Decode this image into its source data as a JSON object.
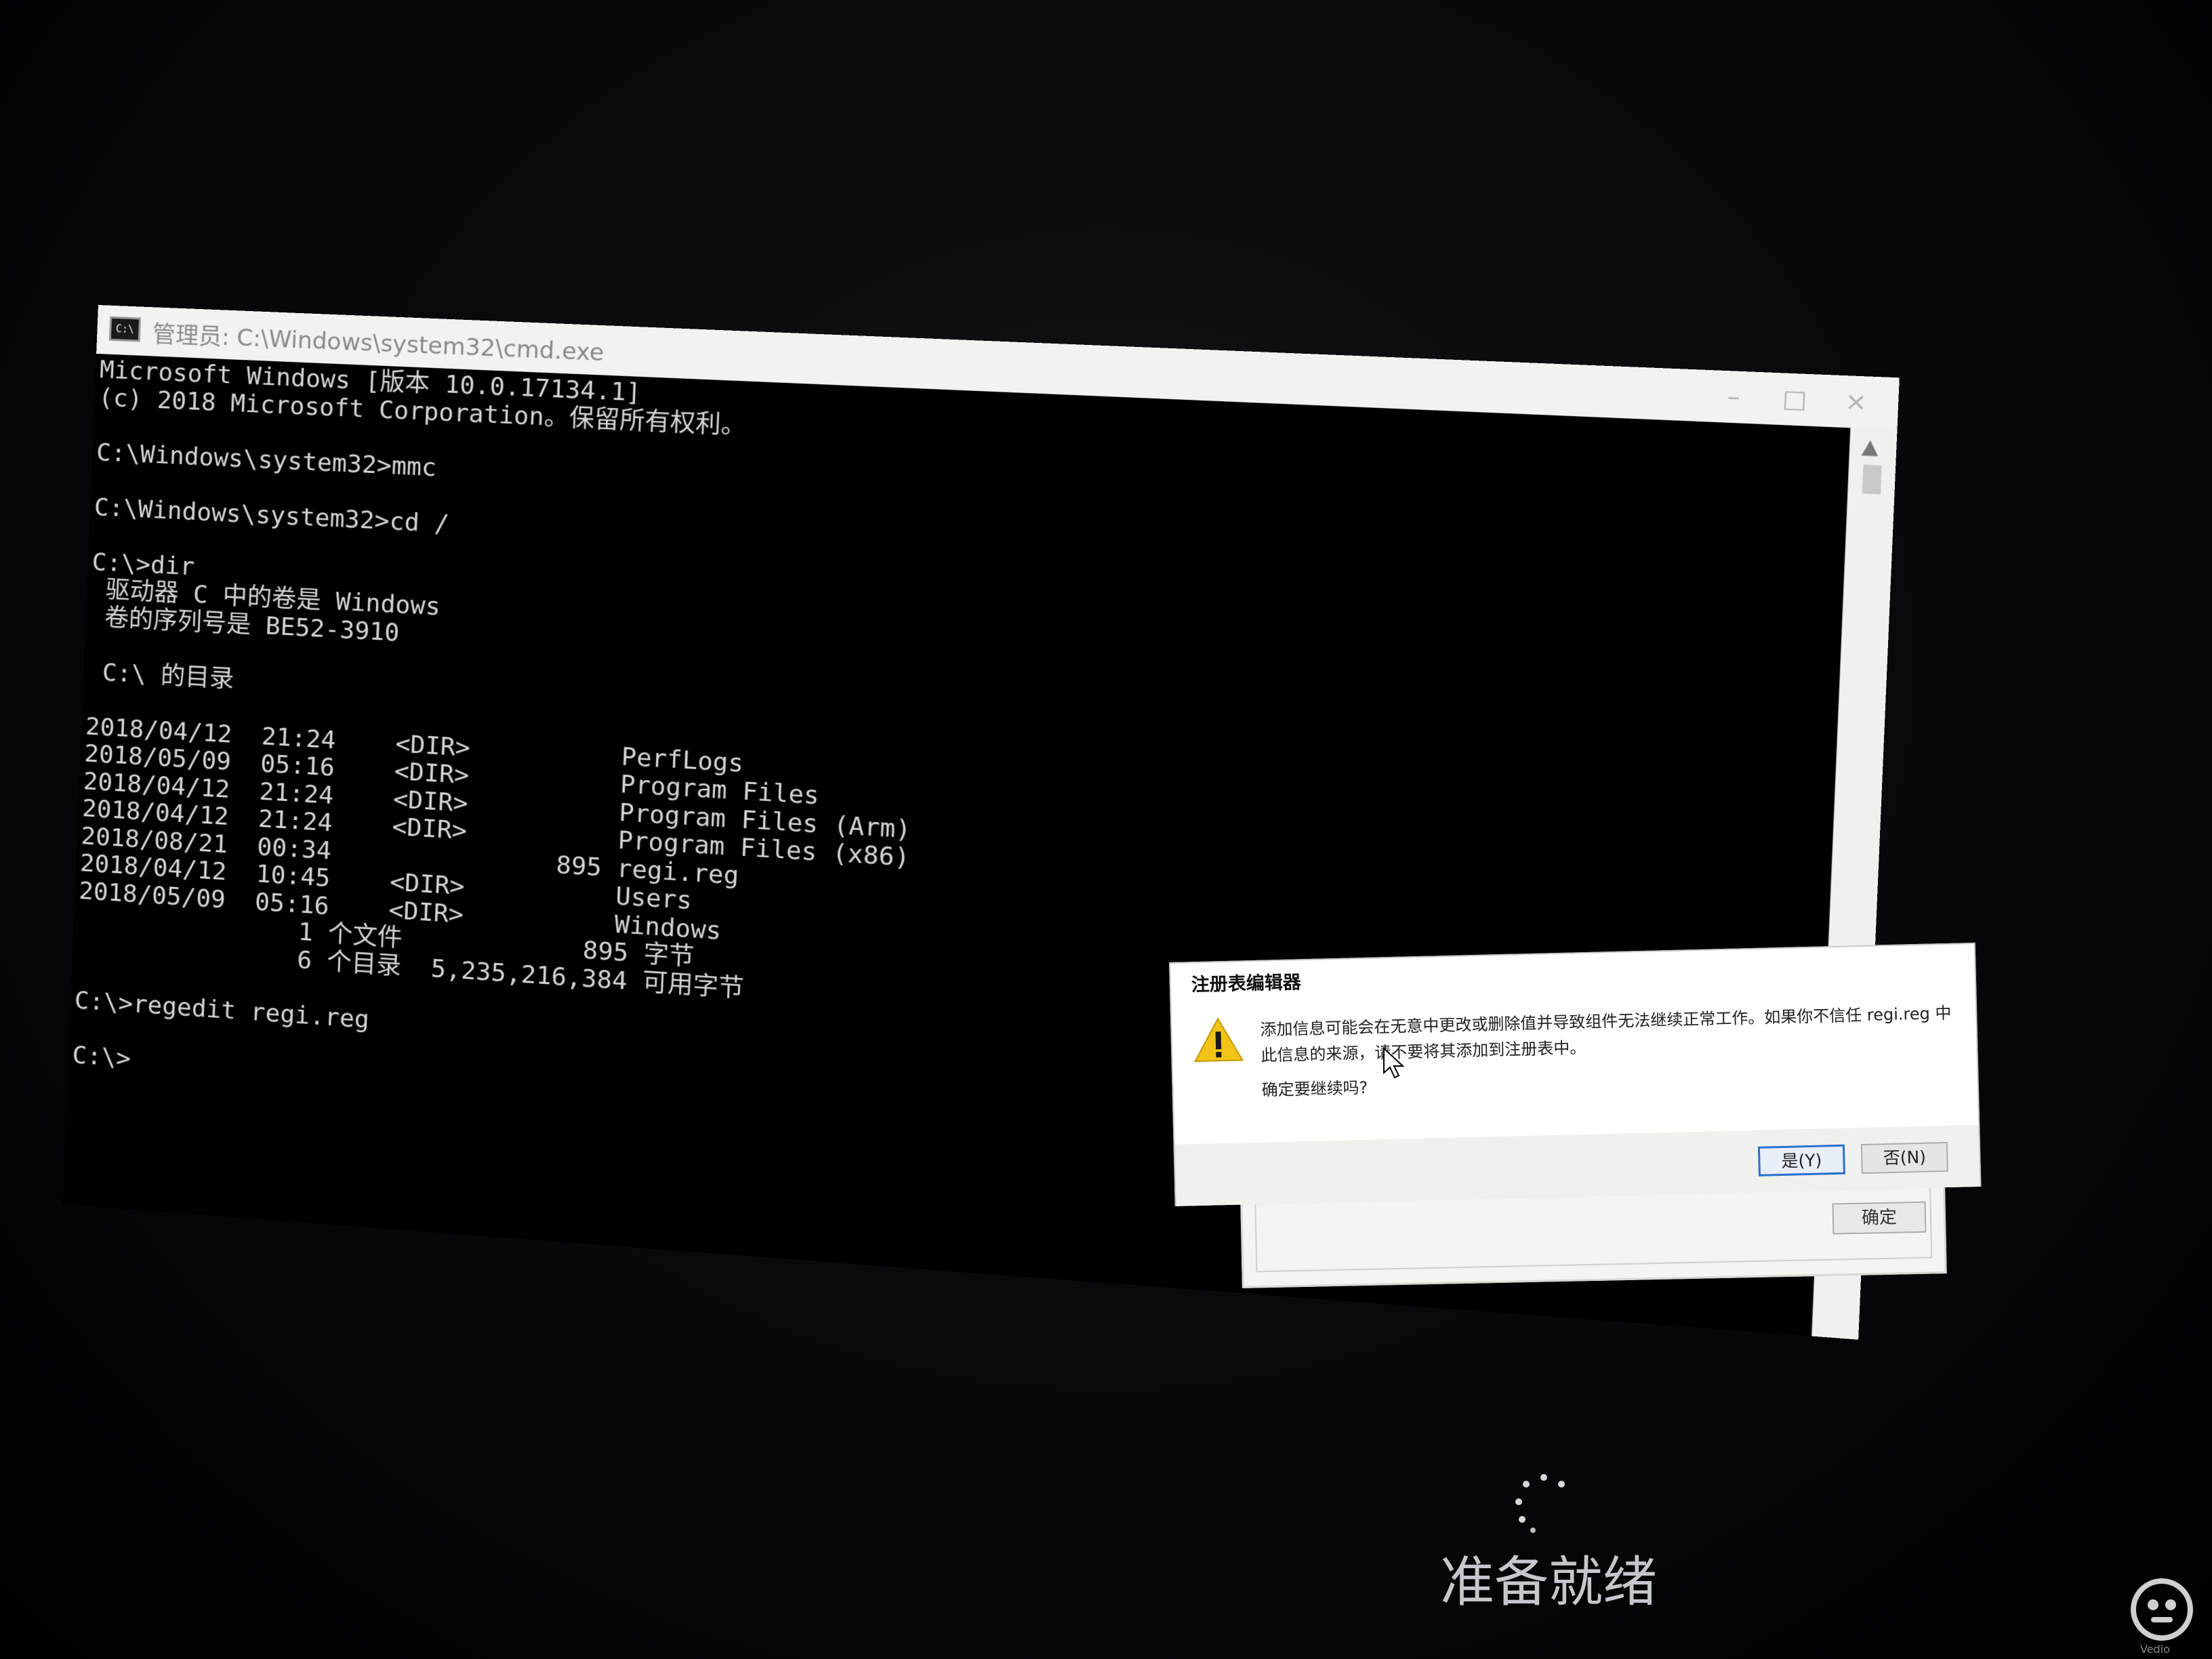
{
  "cmd": {
    "title": "管理员: C:\\Windows\\system32\\cmd.exe",
    "icon_label": "C:\\",
    "controls": {
      "minimize": "–",
      "maximize": "□",
      "close": "×"
    },
    "lines": [
      "Microsoft Windows [版本 10.0.17134.1]",
      "(c) 2018 Microsoft Corporation。保留所有权利。",
      "",
      "C:\\Windows\\system32>mmc",
      "",
      "C:\\Windows\\system32>cd /",
      "",
      "C:\\>dir",
      " 驱动器 C 中的卷是 Windows",
      " 卷的序列号是 BE52-3910",
      "",
      " C:\\ 的目录",
      "",
      "2018/04/12  21:24    <DIR>          PerfLogs",
      "2018/05/09  05:16    <DIR>          Program Files",
      "2018/04/12  21:24    <DIR>          Program Files (Arm)",
      "2018/04/12  21:24    <DIR>          Program Files (x86)",
      "2018/08/21  00:34               895 regi.reg",
      "2018/04/12  10:45    <DIR>          Users",
      "2018/05/09  05:16    <DIR>          Windows",
      "               1 个文件            895 字节",
      "               6 个目录  5,235,216,384 可用字节",
      "",
      "C:\\>regedit regi.reg",
      "",
      "C:\\>"
    ]
  },
  "dialog": {
    "title": "注册表编辑器",
    "icon": "warning-icon",
    "message": "添加信息可能会在无意中更改或删除值并导致组件无法继续正常工作。如果你不信任 regi.reg 中此信息的来源，请不要将其添加到注册表中。",
    "question": "确定要继续吗?",
    "yes_label": "是(Y)",
    "no_label": "否(N)"
  },
  "dialog_back": {
    "ok_label": "确定"
  },
  "status": {
    "loading_text": "准备就绪"
  },
  "watermark": {
    "text": "Vedio"
  },
  "colors": {
    "console_text": "#d4d4d4",
    "console_bg": "#000000",
    "accent_focus": "#2a6fce",
    "warning": "#f3c316"
  }
}
